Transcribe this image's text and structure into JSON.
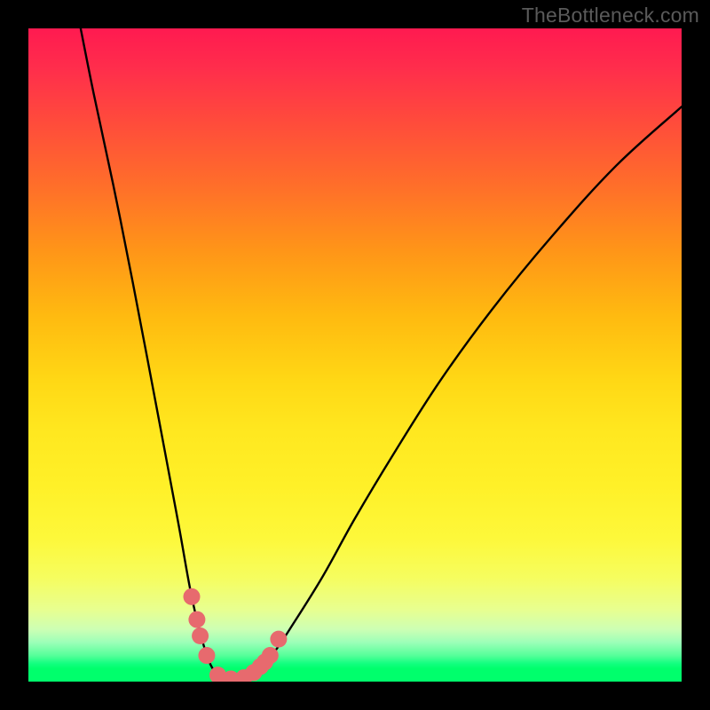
{
  "watermark": "TheBottleneck.com",
  "chart_data": {
    "type": "line",
    "title": "",
    "xlabel": "",
    "ylabel": "",
    "xlim": [
      0,
      100
    ],
    "ylim": [
      0,
      100
    ],
    "grid": false,
    "series": [
      {
        "name": "bottleneck-curve",
        "x": [
          8,
          10,
          13,
          16,
          20,
          23,
          25,
          27,
          28.5,
          30,
          32,
          34,
          36,
          38,
          40,
          45,
          50,
          56,
          63,
          71,
          80,
          90,
          100
        ],
        "y": [
          100,
          90,
          76,
          61,
          40,
          24,
          13,
          5,
          1.5,
          0,
          0,
          1,
          2.5,
          5,
          8,
          16,
          25,
          35,
          46,
          57,
          68,
          79,
          88
        ],
        "color": "#000000"
      }
    ],
    "markers": {
      "name": "highlight-dots",
      "color": "#e76a6e",
      "points": [
        {
          "x": 25.0,
          "y": 13.0
        },
        {
          "x": 25.8,
          "y": 9.5
        },
        {
          "x": 26.3,
          "y": 7.0
        },
        {
          "x": 27.3,
          "y": 4.0
        },
        {
          "x": 29.0,
          "y": 1.0
        },
        {
          "x": 31.0,
          "y": 0.4
        },
        {
          "x": 33.0,
          "y": 0.6
        },
        {
          "x": 34.5,
          "y": 1.4
        },
        {
          "x": 35.5,
          "y": 2.3
        },
        {
          "x": 36.2,
          "y": 3.0
        },
        {
          "x": 37.0,
          "y": 4.0
        },
        {
          "x": 38.3,
          "y": 6.5
        }
      ]
    },
    "background": {
      "type": "vertical-gradient",
      "stops": [
        {
          "pos": 0.0,
          "color": "#ff1a50"
        },
        {
          "pos": 0.34,
          "color": "#ff9518"
        },
        {
          "pos": 0.62,
          "color": "#ffe820"
        },
        {
          "pos": 0.89,
          "color": "#e8ff90"
        },
        {
          "pos": 0.97,
          "color": "#14ff80"
        },
        {
          "pos": 1.0,
          "color": "#00ff6c"
        }
      ]
    }
  }
}
